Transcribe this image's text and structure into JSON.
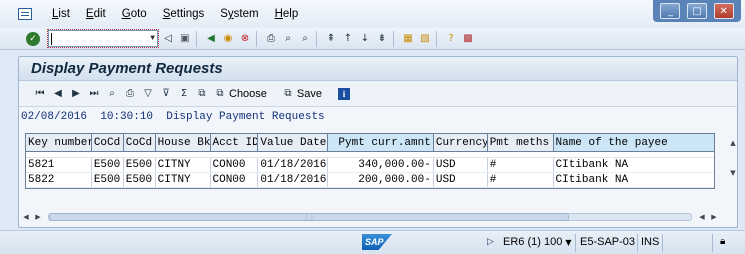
{
  "menu": {
    "items": [
      {
        "label": "List",
        "accel": "L",
        "rest": "ist"
      },
      {
        "label": "Edit",
        "accel": "E",
        "rest": "dit"
      },
      {
        "label": "Goto",
        "accel": "G",
        "rest": "oto"
      },
      {
        "label": "Settings",
        "accel": "S",
        "rest": "ettings"
      },
      {
        "label": "System",
        "accel": "y",
        "pre": "S",
        "rest": "stem"
      },
      {
        "label": "Help",
        "accel": "H",
        "rest": "elp"
      }
    ]
  },
  "window": {
    "minimize": "_",
    "maximize": "□",
    "close": "✕"
  },
  "command": {
    "value": "",
    "dropdown": "▼"
  },
  "page": {
    "title": "Display Payment Requests"
  },
  "app_toolbar": {
    "choose_label": "Choose",
    "save_label": "Save",
    "info_label": "i"
  },
  "list_header": {
    "date": "02/08/2016",
    "time": "10:30:10",
    "title": "Display Payment Requests"
  },
  "table": {
    "columns": [
      "Key number",
      "CoCd",
      "CoCd",
      "House Bk",
      "Acct ID",
      "Value Date",
      "Pymt curr.amnt",
      "Currency",
      "Pmt meths",
      "Name of the payee"
    ],
    "rows": [
      [
        "5821",
        "E500",
        "E500",
        "CITNY",
        "CON00",
        "01/18/2016",
        "340,000.00-",
        "USD",
        "#",
        "CItibank NA"
      ],
      [
        "5822",
        "E500",
        "E500",
        "CITNY",
        "CON00",
        "01/18/2016",
        "200,000.00-",
        "USD",
        "#",
        "CItibank NA"
      ]
    ]
  },
  "statusbar": {
    "logo": "SAP",
    "system": "ER6 (1) 100",
    "server": "E5-SAP-03",
    "mode": "INS"
  },
  "colors": {
    "accent": "#2a5d9b",
    "highlight_column": "#cde6f7",
    "close_button": "#b03c2c"
  }
}
